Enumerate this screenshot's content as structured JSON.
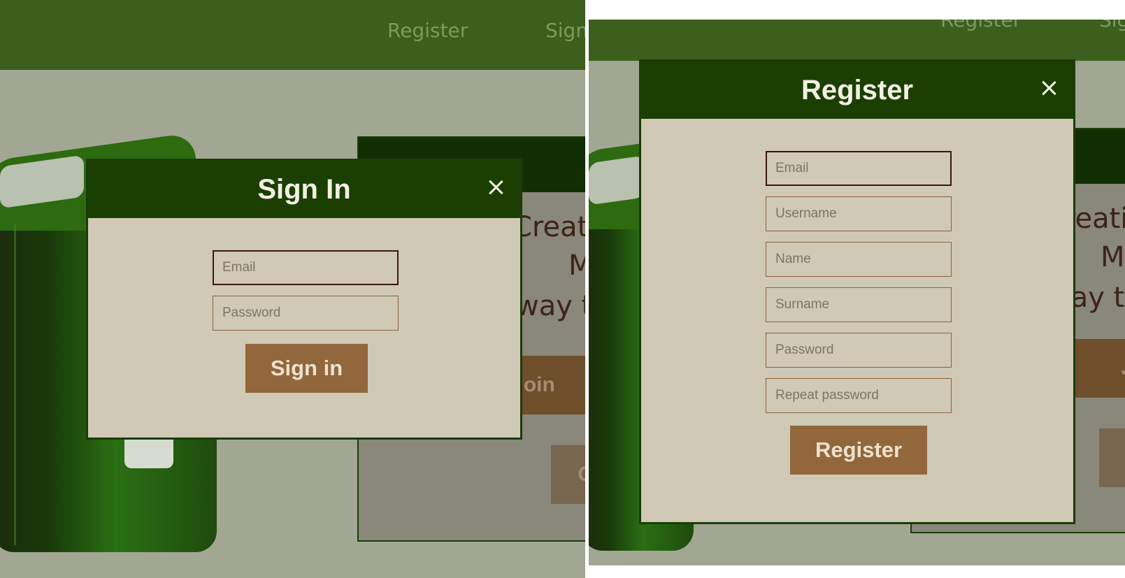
{
  "nav": {
    "register_label": "Register",
    "sign_in_label": "Sign In"
  },
  "hero_card": {
    "line1": "Creati",
    "line2": "M",
    "line3": "way to",
    "join_label": "Join",
    "go_label": "G"
  },
  "sign_in_modal": {
    "title": "Sign In",
    "email_placeholder": "Email",
    "password_placeholder": "Password",
    "submit_label": "Sign in"
  },
  "register_modal": {
    "title": "Register",
    "email_placeholder": "Email",
    "username_placeholder": "Username",
    "name_placeholder": "Name",
    "surname_placeholder": "Surname",
    "password_placeholder": "Password",
    "repeat_password_placeholder": "Repeat password",
    "submit_label": "Register"
  },
  "colors": {
    "nav_bg": "#3c5f1d",
    "modal_header": "#1b3f03",
    "modal_body": "#d0c9b6",
    "button_brown": "#93673c",
    "overlay_bg": "#a2a794"
  }
}
